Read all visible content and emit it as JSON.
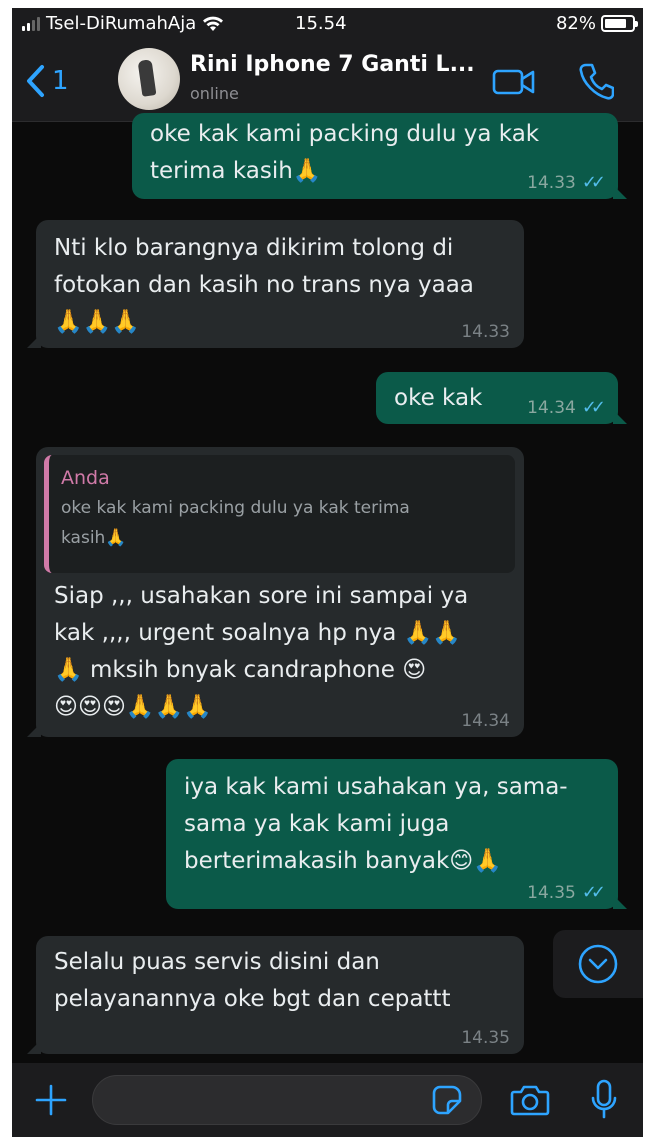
{
  "status_bar": {
    "carrier": "Tsel-DiRumahAja",
    "time": "15.54",
    "battery": "82%",
    "battery_level": 0.82
  },
  "header": {
    "back_count": "1",
    "contact_name": "Rini Iphone 7 Ganti L...",
    "contact_status": "online"
  },
  "messages": [
    {
      "direction": "out",
      "lines": [
        "oke kak kami packing dulu ya kak",
        "terima kasih🙏"
      ],
      "time": "14.33",
      "read": true
    },
    {
      "direction": "in",
      "lines": [
        "Nti klo barangnya dikirim tolong di",
        "fotokan dan kasih no trans nya yaaa",
        "🙏🙏🙏"
      ],
      "time": "14.33"
    },
    {
      "direction": "out",
      "lines": [
        "oke kak"
      ],
      "time": "14.34",
      "read": true
    },
    {
      "direction": "in",
      "quote": {
        "author": "Anda",
        "lines": [
          "oke kak kami packing dulu ya kak terima",
          "kasih🙏"
        ]
      },
      "lines": [
        "Siap ,,, usahakan sore ini sampai ya",
        "kak ,,,, urgent soalnya hp nya 🙏🙏",
        "🙏 mksih bnyak candraphone 😍",
        "😍😍😍🙏🙏🙏"
      ],
      "time": "14.34"
    },
    {
      "direction": "out",
      "lines": [
        "iya kak kami usahakan ya, sama-",
        "sama ya kak kami juga",
        "berterimakasih banyak😊🙏"
      ],
      "time": "14.35",
      "read": true
    },
    {
      "direction": "in",
      "lines": [
        "Selalu puas servis disini dan",
        "pelayanannya oke bgt dan cepattt"
      ],
      "time": "14.35"
    }
  ],
  "input": {
    "placeholder": ""
  },
  "icons": {
    "back": "chevron-left-icon",
    "video": "video-camera-icon",
    "call": "phone-icon",
    "attach": "plus-icon",
    "sticker": "sticker-icon",
    "camera": "camera-icon",
    "mic": "microphone-icon",
    "scroll_down": "chevron-down-circle-icon"
  },
  "colors": {
    "accent": "#2ea4ff",
    "outgoing_bubble": "#0b5a49",
    "incoming_bubble": "#262a2c",
    "read_ticks": "#53bdeb",
    "quote_author": "#d07aa8"
  }
}
